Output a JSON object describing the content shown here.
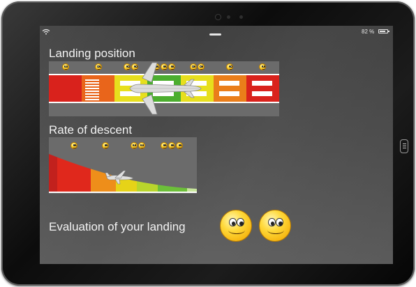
{
  "status_bar": {
    "battery_text": "82 %",
    "battery_level": 0.82,
    "wifi_icon": "wifi-icon"
  },
  "landing_position": {
    "title": "Landing position",
    "segment_colors": [
      "#d9221c",
      "#e9651b",
      "#e7df1d",
      "#4cae2f",
      "#e7df1d",
      "#ea7e1a",
      "#d9221c"
    ],
    "smiley_groups": [
      1,
      1,
      2,
      3,
      2,
      1,
      1
    ]
  },
  "rate_of_descent": {
    "title": "Rate of descent",
    "colors": [
      "#c2211d",
      "#e0281c",
      "#ee8e1a",
      "#e6d318",
      "#b9d52c",
      "#6cbf39",
      "#c7e59b"
    ],
    "smiley_groups": [
      1,
      1,
      2,
      3
    ]
  },
  "evaluation": {
    "label": "Evaluation of your landing",
    "smiley_count": 2
  }
}
